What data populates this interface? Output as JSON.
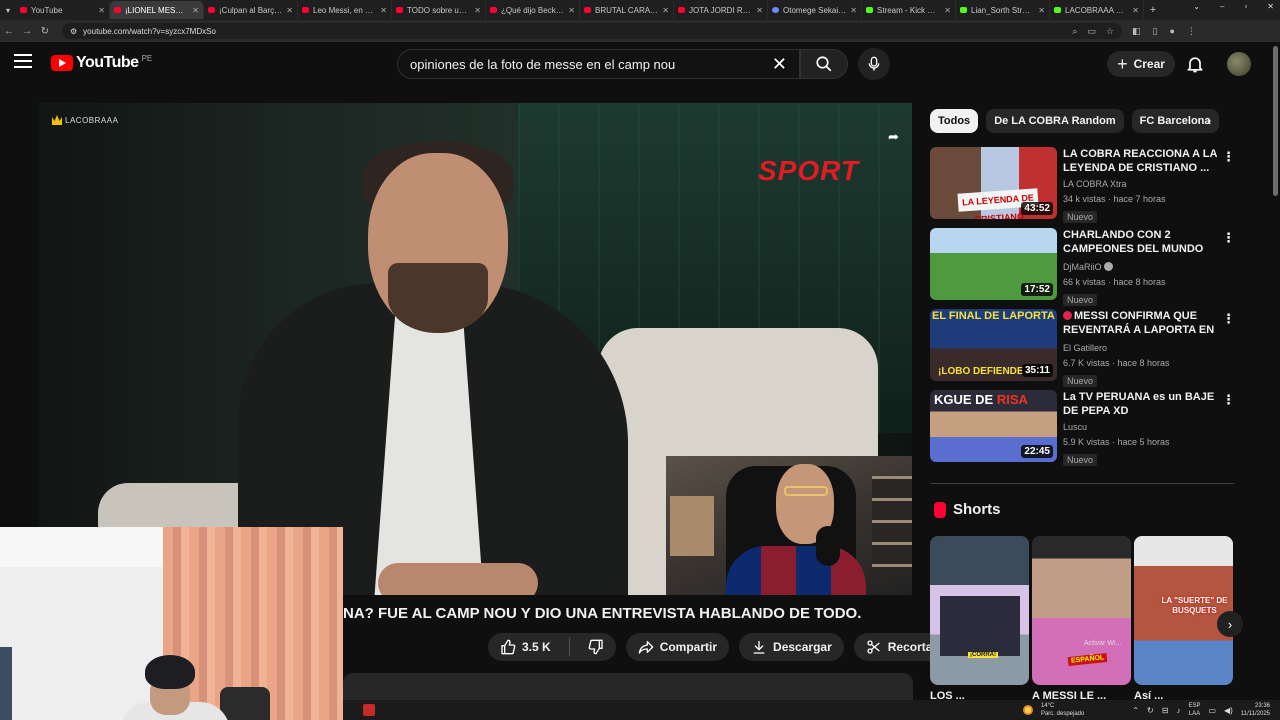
{
  "browser": {
    "tabs": [
      {
        "title": "YouTube",
        "icon": "youtube-icon",
        "active": false
      },
      {
        "title": "¡LIONEL MESSI P...",
        "icon": "youtube-icon",
        "active": true
      },
      {
        "title": "¡Culpan al Barça por l...",
        "icon": "youtube-icon",
        "active": false
      },
      {
        "title": "Leo Messi, en exclusiv...",
        "icon": "youtube-icon",
        "active": false
      },
      {
        "title": "TODO sobre un posib...",
        "icon": "youtube-icon",
        "active": false
      },
      {
        "title": "¿Qué dijo Beckham tr...",
        "icon": "youtube-icon",
        "active": false
      },
      {
        "title": "BRUTAL CARA a CA...",
        "icon": "youtube-icon",
        "active": false
      },
      {
        "title": "JOTA JORDI RABIOSO...",
        "icon": "youtube-icon",
        "active": false
      },
      {
        "title": "Otomege Sekai wa M...",
        "icon": "ai-icon",
        "active": false
      },
      {
        "title": "Stream - Kick Dashbo...",
        "icon": "kick-icon",
        "active": false
      },
      {
        "title": "Lian_Sorth Stream - ...",
        "icon": "kick-icon",
        "active": false
      },
      {
        "title": "LACOBRAAA Stream ...",
        "icon": "kick-icon",
        "active": false
      }
    ],
    "url": "youtube.com/watch?v=syzcx7MDxSo"
  },
  "header": {
    "logo_text": "YouTube",
    "region": "PE",
    "search_query": "opiniones de la foto de messe en el camp nou",
    "create_label": "Crear"
  },
  "player": {
    "watermark": "LACOBRAAA",
    "sport_logo": "SPORT"
  },
  "video": {
    "title": "NA? FUE AL CAMP NOU Y DIO UNA ENTREVISTA HABLANDO DE TODO.",
    "likes": "3.5 K",
    "share_label": "Compartir",
    "download_label": "Descargar",
    "clip_label": "Recortar"
  },
  "chips": [
    "Todos",
    "De LA COBRA Random",
    "FC Barcelona"
  ],
  "recommendations": [
    {
      "title": "LA COBRA REACCIONA A LA LEYENDA DE CRISTIANO ...",
      "channel": "LA COBRA Xtra",
      "meta": "34 k vistas · hace 7 horas",
      "badge": "Nuevo",
      "duration": "43:52",
      "thumb_caption": "LA LEYENDA DE CRISTIANO"
    },
    {
      "title": "CHARLANDO CON 2 CAMPEONES DEL MUNDO EN ...",
      "channel": "DjMaRiiO",
      "meta": "66 k vistas · hace 8 horas",
      "badge": "Nuevo",
      "duration": "17:52",
      "thumb_caption": ""
    },
    {
      "title": "MESSI CONFIRMA QUE REVENTARÁ A LAPORTA EN ...",
      "channel": "El Gatillero",
      "meta": "6.7 K vistas · hace 8 horas",
      "badge": "Nuevo",
      "duration": "35:11",
      "thumb_caption": "EL FINAL DE LAPORTA",
      "thumb_caption2": "¡LOBO DEFIENDE A ..."
    },
    {
      "title": "La TV PERUANA es un BAJE DE PEPA XD",
      "channel": "Luscu",
      "meta": "5.9 K vistas · hace 5 horas",
      "badge": "Nuevo",
      "duration": "22:45",
      "thumb_caption": "KGUE DE",
      "thumb_caption_red": "RISA"
    }
  ],
  "shorts": {
    "title": "Shorts",
    "items": [
      {
        "caption": "¡CORRA!",
        "label": "LOS ..."
      },
      {
        "caption": "ESPAÑOL",
        "caption2": "Activar Wi...",
        "label": "A MESSI LE ..."
      },
      {
        "caption": "LA \"SUERTE\" DE BUSQUETS",
        "label": "Así ..."
      }
    ]
  },
  "taskbar": {
    "temp": "14°C",
    "weather": "Parc. despejado",
    "lang": "ESP",
    "lang2": "LAA",
    "time": "23:36",
    "date": "11/11/2025"
  }
}
